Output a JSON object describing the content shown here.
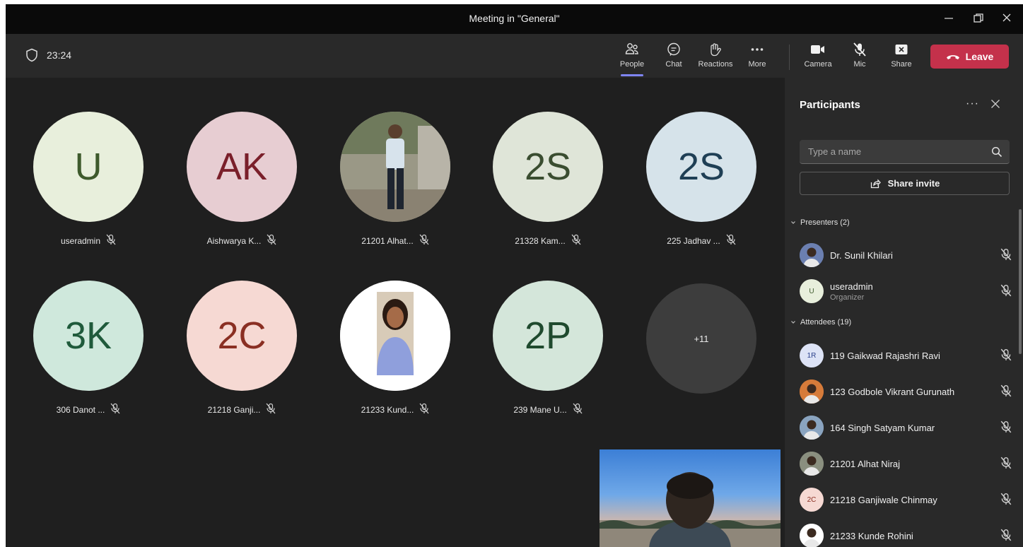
{
  "window": {
    "title": "Meeting in \"General\""
  },
  "topbar": {
    "timer": "23:24",
    "buttons": [
      {
        "label": "People",
        "icon": "people-icon",
        "active": true
      },
      {
        "label": "Chat",
        "icon": "chat-icon"
      },
      {
        "label": "Reactions",
        "icon": "reactions-icon"
      },
      {
        "label": "More",
        "icon": "more-icon"
      },
      {
        "label": "Camera",
        "icon": "camera-icon"
      },
      {
        "label": "Mic",
        "icon": "mic-muted-icon"
      },
      {
        "label": "Share",
        "icon": "share-icon"
      }
    ],
    "leave_label": "Leave"
  },
  "tiles": [
    {
      "initials": "U",
      "name": "useradmin",
      "bg": "#e8efdc",
      "fg": "#3e5a2c"
    },
    {
      "initials": "AK",
      "name": "Aishwarya K...",
      "bg": "#e7cdd2",
      "fg": "#7a1f2a"
    },
    {
      "initials": "",
      "name": "21201 Alhat...",
      "bg": "#8a8f7f",
      "fg": "#ffffff",
      "photo": "photo-man-standing"
    },
    {
      "initials": "2S",
      "name": "21328 Kam...",
      "bg": "#dfe5d8",
      "fg": "#3a4d30"
    },
    {
      "initials": "2S",
      "name": "225 Jadhav ...",
      "bg": "#d6e3ea",
      "fg": "#1f3f55"
    },
    {
      "initials": "3K",
      "name": "306 Danot ...",
      "bg": "#cfe8dc",
      "fg": "#1f5a3b"
    },
    {
      "initials": "2C",
      "name": "21218 Ganji...",
      "bg": "#f6d9d3",
      "fg": "#8a2f23"
    },
    {
      "initials": "",
      "name": "21233 Kund...",
      "bg": "#ffffff",
      "fg": "#ffffff",
      "photo": "photo-woman"
    },
    {
      "initials": "2P",
      "name": "239 Mane U...",
      "bg": "#d4e6da",
      "fg": "#1f4a2e"
    }
  ],
  "overflow_count": "+11",
  "panel": {
    "title": "Participants",
    "search_placeholder": "Type a name",
    "share_invite": "Share invite",
    "presenters_label": "Presenters (2)",
    "attendees_label": "Attendees (19)",
    "presenters": [
      {
        "name": "Dr. Sunil Khilari",
        "sub": "",
        "initials": "",
        "bg": "#6b7fb0",
        "fg": "#fff",
        "photo": true
      },
      {
        "name": "useradmin",
        "sub": "Organizer",
        "initials": "U",
        "bg": "#e8efdc",
        "fg": "#3e5a2c"
      }
    ],
    "attendees": [
      {
        "name": "119 Gaikwad Rajashri Ravi",
        "initials": "1R",
        "bg": "#dde3f6",
        "fg": "#2b3f8a"
      },
      {
        "name": "123 Godbole Vikrant Gurunath",
        "initials": "",
        "bg": "#d67b3a",
        "fg": "#fff",
        "photo": true
      },
      {
        "name": "164 Singh Satyam Kumar",
        "initials": "",
        "bg": "#8aa4c0",
        "fg": "#fff",
        "photo": true
      },
      {
        "name": "21201 Alhat Niraj",
        "initials": "",
        "bg": "#8a8f7f",
        "fg": "#fff",
        "photo": true
      },
      {
        "name": "21218 Ganjiwale Chinmay",
        "initials": "2C",
        "bg": "#f6d9d3",
        "fg": "#8a2f23"
      },
      {
        "name": "21233 Kunde Rohini",
        "initials": "",
        "bg": "#ffffff",
        "fg": "#fff",
        "photo": true
      }
    ]
  },
  "colors": {
    "accent": "#7f85f5",
    "leave": "#c4314b",
    "stage": "#1f1f1f",
    "panel": "#292929"
  }
}
